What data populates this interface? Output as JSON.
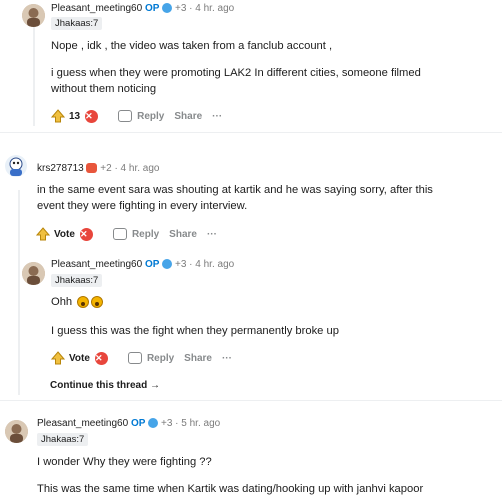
{
  "comments": [
    {
      "username": "Pleasant_meeting60",
      "op_label": "OP",
      "karma": "+3",
      "time": "· 4 hr. ago",
      "flair": "Jhakaas:7",
      "body": [
        "Nope , idk , the video was taken from a fanclub account ,",
        "i guess when they were promoting LAK2 In different cities, someone filmed",
        "without them noticing"
      ],
      "votes": "13",
      "reply_label": "Reply",
      "share_label": "Share",
      "more_label": "···"
    },
    {
      "username": "krs278713",
      "karma": "+2",
      "time": "· 4 hr. ago",
      "body": [
        "in the same event sara was shouting at kartik and he was saying sorry, after this",
        "event they were fighting in every interview."
      ],
      "votes": "Vote",
      "reply_label": "Reply",
      "share_label": "Share",
      "more_label": "···"
    },
    {
      "username": "Pleasant_meeting60",
      "op_label": "OP",
      "karma": "+3",
      "time": "· 4 hr. ago",
      "flair": "Jhakaas:7",
      "body": [
        "Ohh",
        "I guess this was the fight when they permanently broke up"
      ],
      "votes": "Vote",
      "reply_label": "Reply",
      "share_label": "Share",
      "more_label": "···",
      "continue_label": "Continue this thread →"
    },
    {
      "username": "Pleasant_meeting60",
      "op_label": "OP",
      "karma": "+3",
      "time": "· 5 hr. ago",
      "flair": "Jhakaas:7",
      "body": [
        "I wonder Why they were fighting ??",
        "This was the same time when Kartik was dating/hooking up with janhvi kapoor"
      ]
    }
  ],
  "colors": {
    "op": "#0079d3",
    "downvote": "#e8463c",
    "meta": "#7c7c7c"
  },
  "icons": [
    "avatar",
    "badge-icon",
    "upvote-icon",
    "downvote-icon",
    "reply-icon",
    "more-icon",
    "emoji-icon"
  ]
}
